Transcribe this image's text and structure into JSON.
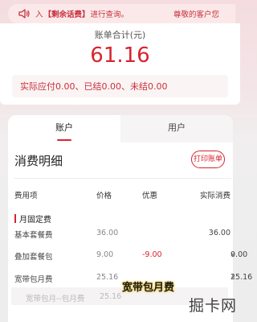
{
  "notice": {
    "prefix": "入",
    "highlight": "【剩余话费】",
    "suffix": "进行查询。",
    "right": "尊敬的客户您"
  },
  "summary": {
    "label": "账单合计(元)",
    "amount": "61.16",
    "breakdown_text": "实际应付0.00、已结0.00、未结0.00"
  },
  "tabs": [
    {
      "label": "账户"
    },
    {
      "label": "用户"
    }
  ],
  "detail": {
    "title": "消费明细",
    "print_button": "打印账单",
    "columns": [
      "费用项",
      "价格",
      "优惠",
      "实际消费"
    ],
    "group": "月固定费",
    "rows": [
      {
        "name": "基本套餐费",
        "price": "36.00",
        "discount": "",
        "actual": "36.00",
        "expand": ""
      },
      {
        "name": "叠加套餐包",
        "price": "9.00",
        "discount": "-9.00",
        "actual": "0.00",
        "expand": "∨"
      },
      {
        "name": "宽带包月费",
        "price": "25.16",
        "discount": "",
        "actual": "25.16",
        "expand": "∧"
      }
    ],
    "sub_row": {
      "name": "宽带包月--包月费",
      "price": "25.16"
    }
  },
  "overlay": "宽带包月费",
  "watermark": "掘卡网",
  "colors": {
    "accent": "#d8232f",
    "background": "#ededed"
  },
  "icons": {
    "notice": "speaker-icon"
  }
}
